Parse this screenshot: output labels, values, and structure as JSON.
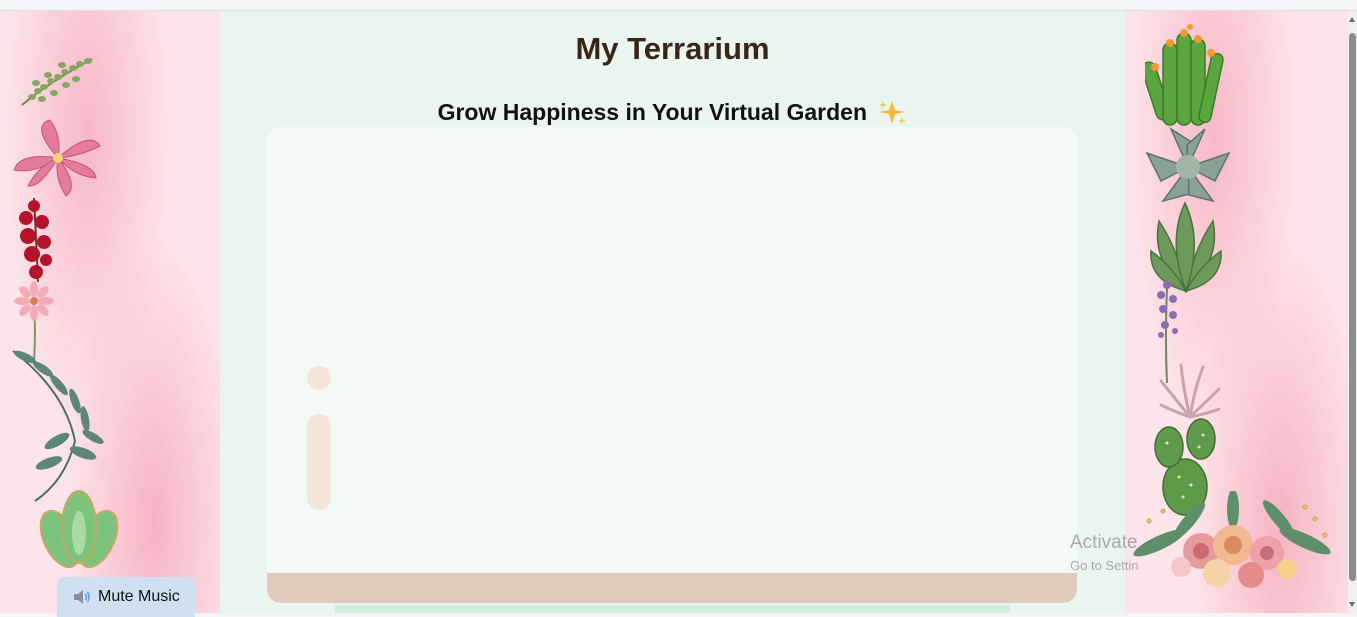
{
  "page": {
    "title": "My Terrarium",
    "subtitle": "Grow Happiness in Your Virtual Garden",
    "subtitle_icon": "sparkles-icon"
  },
  "music_button": {
    "label": "Mute Music",
    "icon": "speaker-icon"
  },
  "watermark": {
    "line1": "Activate",
    "line2": "Go to Settin"
  },
  "colors": {
    "background_main": "#e9f5ee",
    "side_panel": "#fde4ea",
    "jar": "#f3faf5",
    "jar_base": "#dfcabb",
    "title": "#3a2418"
  },
  "plants": {
    "left": [
      "plant-fern-sprig",
      "plant-pink-lily",
      "plant-red-orchid",
      "plant-daisy",
      "plant-eucalyptus",
      "plant-green-succulent"
    ],
    "right": [
      "plant-cactus-flowering",
      "plant-echeveria",
      "plant-aloe",
      "plant-lavender",
      "plant-air-plant",
      "plant-paddle-cactus",
      "plant-flower-bouquet"
    ]
  }
}
